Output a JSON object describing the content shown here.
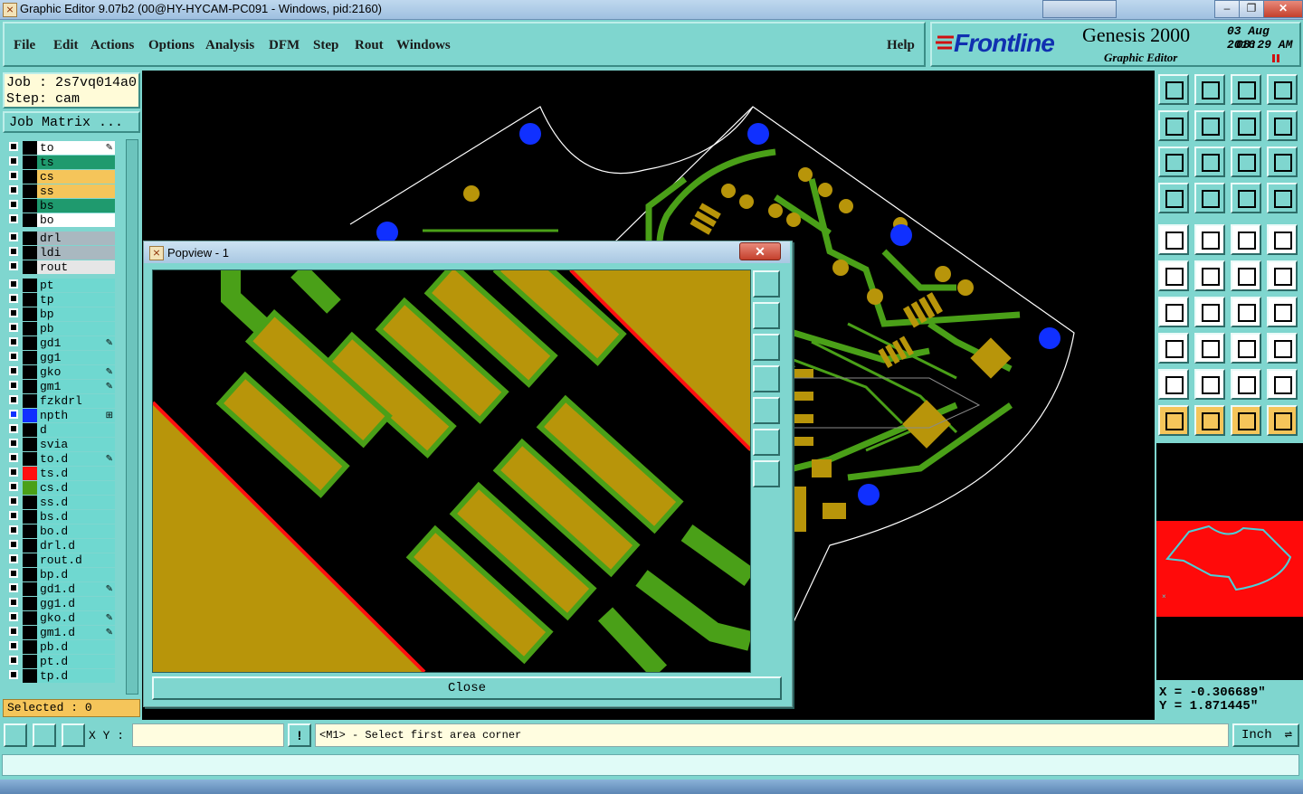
{
  "window": {
    "title": "Graphic Editor 9.07b2 (00@HY-HYCAM-PC091 - Windows, pid:2160)"
  },
  "menu": {
    "items": [
      "File",
      "Edit",
      "Actions",
      "Options",
      "Analysis",
      "DFM",
      "Step",
      "Rout",
      "Windows"
    ],
    "help": "Help"
  },
  "brand": {
    "logo": "Frontline",
    "product": "Genesis 2000",
    "subtitle": "Graphic Editor",
    "date": "03 Aug 2016",
    "time": "08:29 AM"
  },
  "job": {
    "job_label": "Job : 2s7vq014a0",
    "step_label": "Step: cam",
    "matrix_button": "Job Matrix ..."
  },
  "layers": [
    {
      "name": "to",
      "bg": "#ffffff",
      "mark": "✎"
    },
    {
      "name": "ts",
      "bg": "#1f9a6e",
      "mark": ""
    },
    {
      "name": "cs",
      "bg": "#f5c55a",
      "mark": ""
    },
    {
      "name": "ss",
      "bg": "#f5c55a",
      "mark": ""
    },
    {
      "name": "bs",
      "bg": "#1f9a6e",
      "mark": ""
    },
    {
      "name": "bo",
      "bg": "#ffffff",
      "mark": ""
    },
    {
      "name": "drl",
      "bg": "#a9b8c0",
      "mark": ""
    },
    {
      "name": "ldi",
      "bg": "#a9b8c0",
      "mark": ""
    },
    {
      "name": "rout",
      "bg": "#e6e6e6",
      "mark": ""
    },
    {
      "name": "pt",
      "bg": "#6fd8d0",
      "mark": ""
    },
    {
      "name": "tp",
      "bg": "#6fd8d0",
      "mark": ""
    },
    {
      "name": "bp",
      "bg": "#6fd8d0",
      "mark": ""
    },
    {
      "name": "pb",
      "bg": "#6fd8d0",
      "mark": ""
    },
    {
      "name": "gd1",
      "bg": "#6fd8d0",
      "mark": "✎"
    },
    {
      "name": "gg1",
      "bg": "#6fd8d0",
      "mark": ""
    },
    {
      "name": "gko",
      "bg": "#6fd8d0",
      "mark": "✎"
    },
    {
      "name": "gm1",
      "bg": "#6fd8d0",
      "mark": "✎"
    },
    {
      "name": "fzkdrl",
      "bg": "#6fd8d0",
      "mark": ""
    },
    {
      "name": "npth",
      "bg": "#6fd8d0",
      "mark": "⊞"
    },
    {
      "name": "d",
      "bg": "#6fd8d0",
      "mark": ""
    },
    {
      "name": "svia",
      "bg": "#6fd8d0",
      "mark": ""
    },
    {
      "name": "to.d",
      "bg": "#6fd8d0",
      "mark": "✎"
    },
    {
      "name": "ts.d",
      "bg": "#6fd8d0",
      "mark": ""
    },
    {
      "name": "cs.d",
      "bg": "#6fd8d0",
      "mark": ""
    },
    {
      "name": "ss.d",
      "bg": "#6fd8d0",
      "mark": ""
    },
    {
      "name": "bs.d",
      "bg": "#6fd8d0",
      "mark": ""
    },
    {
      "name": "bo.d",
      "bg": "#6fd8d0",
      "mark": ""
    },
    {
      "name": "drl.d",
      "bg": "#6fd8d0",
      "mark": ""
    },
    {
      "name": "rout.d",
      "bg": "#6fd8d0",
      "mark": ""
    },
    {
      "name": "bp.d",
      "bg": "#6fd8d0",
      "mark": ""
    },
    {
      "name": "gd1.d",
      "bg": "#6fd8d0",
      "mark": "✎"
    },
    {
      "name": "gg1.d",
      "bg": "#6fd8d0",
      "mark": ""
    },
    {
      "name": "gko.d",
      "bg": "#6fd8d0",
      "mark": "✎"
    },
    {
      "name": "gm1.d",
      "bg": "#6fd8d0",
      "mark": "✎"
    },
    {
      "name": "pb.d",
      "bg": "#6fd8d0",
      "mark": ""
    },
    {
      "name": "pt.d",
      "bg": "#6fd8d0",
      "mark": ""
    },
    {
      "name": "tp.d",
      "bg": "#6fd8d0",
      "mark": ""
    }
  ],
  "selected": "Selected : 0",
  "popview": {
    "title": "Popview - 1",
    "close_x": "✕",
    "close_button": "Close"
  },
  "coords": {
    "x": "X = -0.306689\"",
    "y": "Y = 1.871445\""
  },
  "status": {
    "xy_label": "X Y :",
    "xy_value": "",
    "prompt": "<M1> - Select first area corner",
    "unit": "Inch",
    "bang": "!"
  },
  "colors": {
    "panel": "#7fd6cf",
    "copper": "#b8950a",
    "trace": "#4aa018",
    "via": "#1030ff",
    "outline": "#ff1010"
  }
}
